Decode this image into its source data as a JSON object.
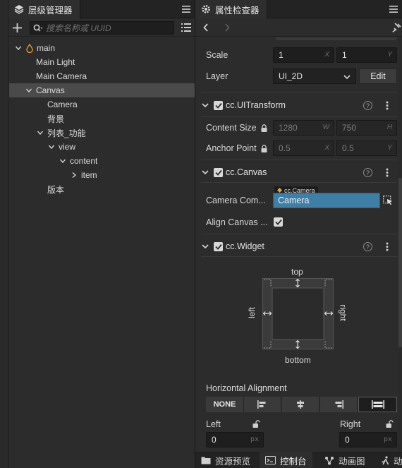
{
  "hierarchy": {
    "tab_title": "层级管理器",
    "search_placeholder": "搜索名称或 UUID",
    "nodes": [
      {
        "label": "main"
      },
      {
        "label": "Main Light"
      },
      {
        "label": "Main Camera"
      },
      {
        "label": "Canvas"
      },
      {
        "label": "Camera"
      },
      {
        "label": "背景"
      },
      {
        "label": "列表_功能"
      },
      {
        "label": "view"
      },
      {
        "label": "content"
      },
      {
        "label": "item"
      },
      {
        "label": "版本"
      }
    ]
  },
  "inspector": {
    "tab_title": "属性检查器",
    "scale": {
      "label": "Scale",
      "x": "1",
      "y": "1",
      "x_axis": "X",
      "y_axis": "Y"
    },
    "layer": {
      "label": "Layer",
      "value": "UI_2D",
      "edit_label": "Edit"
    },
    "ui_transform": {
      "name": "cc.UITransform",
      "content_size": {
        "label": "Content Size",
        "w": "1280",
        "h": "750",
        "w_axis": "W",
        "h_axis": "H"
      },
      "anchor_point": {
        "label": "Anchor Point",
        "x": "0.5",
        "y": "0.5",
        "x_axis": "X",
        "y_axis": "Y"
      }
    },
    "canvas": {
      "name": "cc.Canvas",
      "camera_component": {
        "label": "Camera Com...",
        "tooltip": "cc.Camera",
        "value": "Camera"
      },
      "align_canvas": {
        "label": "Align Canvas ..."
      }
    },
    "widget": {
      "name": "cc.Widget",
      "top": "top",
      "bottom": "bottom",
      "left": "left",
      "right": "right",
      "horizontal_alignment": "Horizontal Alignment",
      "none_label": "NONE",
      "left_label": "Left",
      "right_label": "Right",
      "left_value": "0",
      "right_value": "0",
      "unit": "px"
    }
  },
  "bottom_tabs": [
    {
      "label": "资源预览"
    },
    {
      "label": "控制台"
    },
    {
      "label": "动画图"
    },
    {
      "label": "动"
    }
  ],
  "colors": {
    "accent": "#3f7fa6",
    "check": "#d8d8d8",
    "bg": "#2c2c2c"
  }
}
